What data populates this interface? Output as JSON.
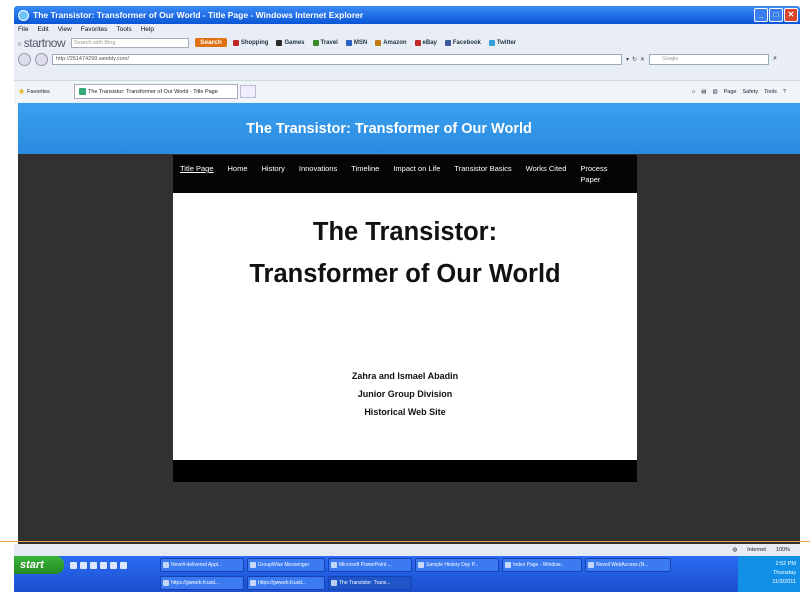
{
  "window": {
    "title": "The Transistor: Transformer of Our World - Title Page - Windows Internet Explorer"
  },
  "menu": [
    "File",
    "Edit",
    "View",
    "Favorites",
    "Tools",
    "Help"
  ],
  "toolbar": {
    "logo": "startnow",
    "search_placeholder": "Search with Bing",
    "search_button": "Search",
    "links": [
      {
        "label": "Shopping",
        "color": "#c02828"
      },
      {
        "label": "Games",
        "color": "#2a2a2a"
      },
      {
        "label": "Travel",
        "color": "#3b8a2a"
      },
      {
        "label": "MSN",
        "color": "#2a62c0"
      },
      {
        "label": "Amazon",
        "color": "#c07a10"
      },
      {
        "label": "eBay",
        "color": "#c02828"
      },
      {
        "label": "Facebook",
        "color": "#3b5998"
      },
      {
        "label": "Twitter",
        "color": "#33a0d8"
      }
    ]
  },
  "address": {
    "url": "http://251474299.weebly.com/",
    "google_placeholder": "Google"
  },
  "favorites": {
    "label": "Favorites",
    "tab_title": "The Transistor: Transformer of Our World - Title Page"
  },
  "command_bar": [
    "Page",
    "Safety",
    "Tools"
  ],
  "site": {
    "header_title": "The Transistor: Transformer of Our World",
    "nav": [
      "Title Page",
      "Home",
      "History",
      "Innovations",
      "Timeline",
      "Impact on Life",
      "Transistor Basics",
      "Works Cited",
      "Process Paper"
    ],
    "heading_line1": "The Transistor:",
    "heading_line2": "Transformer of Our World",
    "credits": [
      "Zahra and Ismael Abadin",
      "Junior Group Division",
      "Historical Web Site"
    ]
  },
  "status": {
    "zone": "Internet",
    "zoom": "100%"
  },
  "taskbar": {
    "start": "start",
    "row1": [
      "Novell-delivered Appl...",
      "GroupWise Messenger",
      "Microsoft PowerPoint ...",
      "Sample History Day P...",
      "Index Page - Window...",
      "Novell WebAccess (N..."
    ],
    "row2": [
      "https://gwweb.fcusd...",
      "https://gwweb.fcusd...",
      "The Transistor: Trans..."
    ],
    "clock_time": "2:52 PM",
    "clock_day": "Thursday",
    "clock_date": "11/3/2011"
  }
}
